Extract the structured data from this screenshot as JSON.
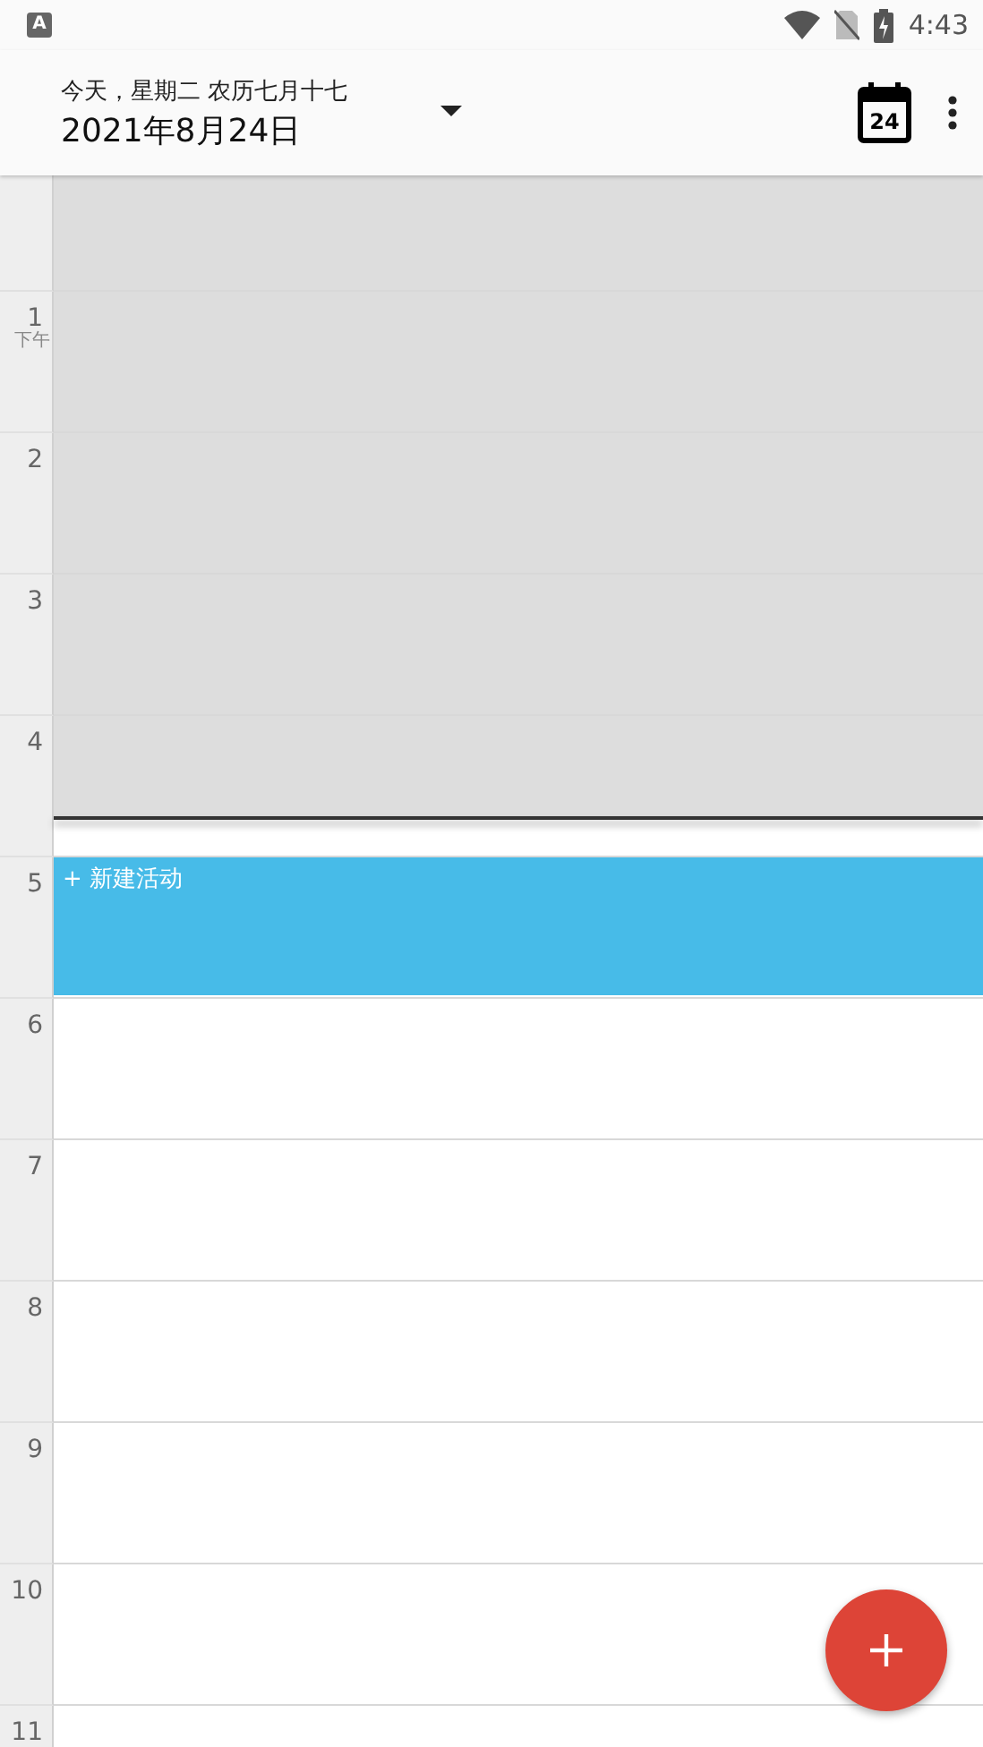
{
  "status_bar": {
    "notification_letter": "A",
    "time": "4:43"
  },
  "header": {
    "subtitle": "今天，星期二  农历七月十七",
    "date": "2021年8月24日",
    "today_day": "24"
  },
  "hours": [
    {
      "label": "1",
      "meridiem": "下午",
      "past": true
    },
    {
      "label": "2",
      "past": true
    },
    {
      "label": "3",
      "past": true
    },
    {
      "label": "4",
      "past": true,
      "now_line": true
    },
    {
      "label": "5",
      "past": false,
      "event": "+ 新建活动",
      "color": "#47bbe8"
    },
    {
      "label": "6",
      "past": false
    },
    {
      "label": "7",
      "past": false
    },
    {
      "label": "8",
      "past": false
    },
    {
      "label": "9",
      "past": false
    },
    {
      "label": "10",
      "past": false
    },
    {
      "label": "11",
      "past": false
    }
  ],
  "top_row_past": true
}
